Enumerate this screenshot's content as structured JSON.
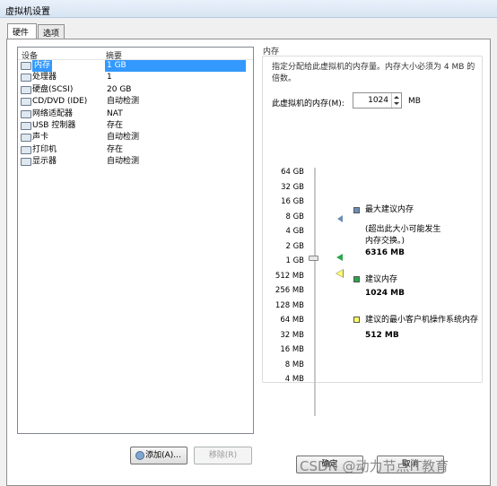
{
  "window": {
    "title": "虚拟机设置"
  },
  "tabs": [
    {
      "label": "硬件",
      "active": true
    },
    {
      "label": "选项",
      "active": false
    }
  ],
  "device_list": {
    "headers": {
      "device": "设备",
      "summary": "摘要"
    },
    "rows": [
      {
        "name": "内存",
        "summary": "1 GB",
        "icon": "memory-icon",
        "selected": true
      },
      {
        "name": "处理器",
        "summary": "1",
        "icon": "processor-icon",
        "selected": false
      },
      {
        "name": "硬盘(SCSI)",
        "summary": "20 GB",
        "icon": "hard-disk-icon",
        "selected": false
      },
      {
        "name": "CD/DVD (IDE)",
        "summary": "自动检测",
        "icon": "cd-dvd-icon",
        "selected": false
      },
      {
        "name": "网络适配器",
        "summary": "NAT",
        "icon": "network-adapter-icon",
        "selected": false
      },
      {
        "name": "USB 控制器",
        "summary": "存在",
        "icon": "usb-controller-icon",
        "selected": false
      },
      {
        "name": "声卡",
        "summary": "自动检测",
        "icon": "sound-card-icon",
        "selected": false
      },
      {
        "name": "打印机",
        "summary": "存在",
        "icon": "printer-icon",
        "selected": false
      },
      {
        "name": "显示器",
        "summary": "自动检测",
        "icon": "display-icon",
        "selected": false
      }
    ]
  },
  "buttons": {
    "add": "添加(A)...",
    "remove": "移除(R)",
    "confirm": "确定",
    "cancel": "取消"
  },
  "memory": {
    "group_title": "内存",
    "description": "指定分配给此虚拟机的内存量。内存大小必须为 4 MB 的倍数。",
    "input_label": "此虚拟机的内存(M):",
    "value": "1024",
    "unit": "MB",
    "scale_labels": [
      "64 GB",
      "32 GB",
      "16 GB",
      "8 GB",
      "4 GB",
      "2 GB",
      "1 GB",
      "512 MB",
      "256 MB",
      "128 MB",
      "64 MB",
      "32 MB",
      "16 MB",
      "8 MB",
      "4 MB"
    ],
    "legend": {
      "max_label": "最大建议内存",
      "max_note": "(超出此大小可能发生内存交换。)",
      "max_value": "6316 MB",
      "rec_label": "建议内存",
      "rec_value": "1024 MB",
      "min_label": "建议的最小客户机操作系统内存",
      "min_value": "512 MB"
    },
    "colors": {
      "max": "#6b8fb5",
      "recommended": "#2aa64a",
      "minimum": "#ffff66"
    }
  },
  "watermark": "CSDN @动力节点IT教育"
}
